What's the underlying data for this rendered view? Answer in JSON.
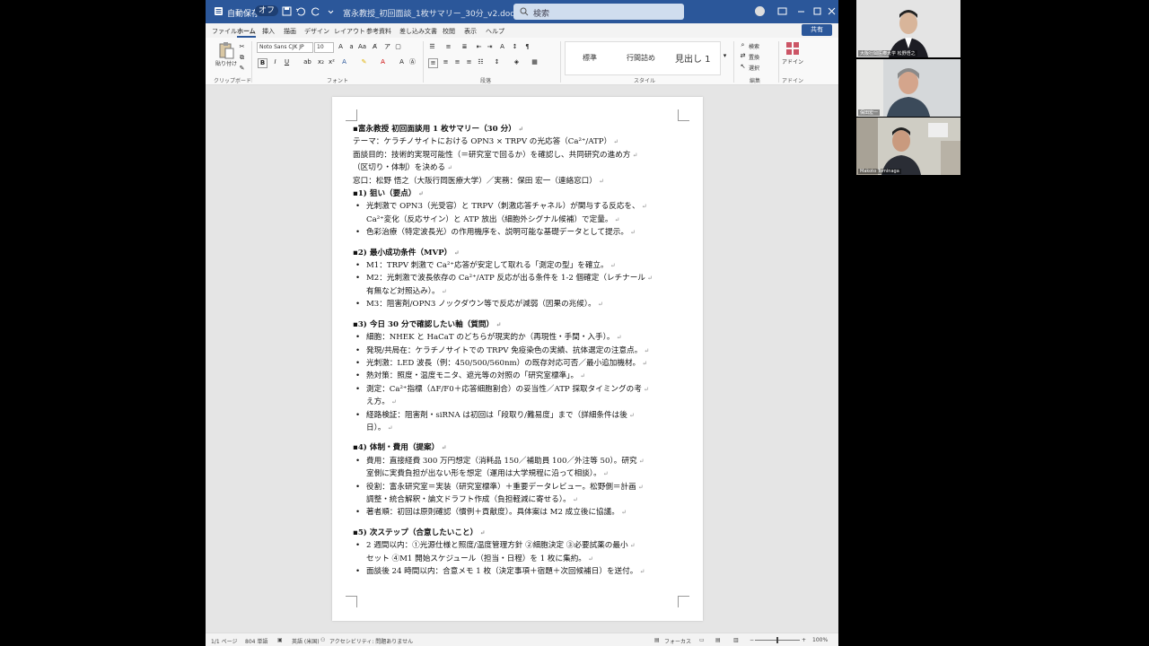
{
  "window": {
    "autosave_label": "自動保存",
    "autosave_state": "オフ",
    "doc_title": "富永教授_初回面談_1枚サマリー_30分_v2.docx ・ 保存",
    "search_placeholder": "検索"
  },
  "menu": {
    "tabs": [
      "ファイル",
      "ホーム",
      "挿入",
      "描画",
      "デザイン",
      "レイアウト",
      "参考資料",
      "差し込み文書",
      "校閲",
      "表示",
      "ヘルプ"
    ],
    "share_label": "共有"
  },
  "ribbon": {
    "paste_label": "貼り付け",
    "font_name": "Noto Sans CJK JP",
    "font_size": "10",
    "styles": [
      "標準",
      "行間詰め",
      "見出し 1"
    ],
    "find_label": "検索",
    "replace_label": "置換",
    "select_label": "選択",
    "addin_label": "アドイン",
    "groups": {
      "clipboard": "クリップボード",
      "font": "フォント",
      "paragraph": "段落",
      "style": "スタイル",
      "edit": "編集",
      "addin": "アドイン"
    }
  },
  "document": {
    "lines": [
      {
        "t": "▪富永教授 初回面談用 1 枚サマリー（30 分）",
        "k": "h"
      },
      {
        "t": "テーマ：ケラチノサイトにおける OPN3 × TRPV の光応答（Ca²⁺/ATP）",
        "k": "p"
      },
      {
        "t": "面談目的：技術的実現可能性（＝研究室で回るか）を確認し、共同研究の進め方",
        "k": "p"
      },
      {
        "t": "（区切り・体制）を決める",
        "k": "p"
      },
      {
        "t": "窓口：松野 悟之（大阪行岡医療大学）／実務：保田 宏一（連絡窓口）",
        "k": "p"
      },
      {
        "t": "▪1) 狙い（要点）",
        "k": "h"
      },
      {
        "t": "光刺激で OPN3（光受容）と TRPV（刺激応答チャネル）が関与する反応を、",
        "k": "b"
      },
      {
        "t": "Ca²⁺変化（反応サイン）と ATP 放出（細胞外シグナル候補）で定量。",
        "k": "c"
      },
      {
        "t": "色彩治療（特定波長光）の作用機序を、説明可能な基礎データとして提示。",
        "k": "b"
      },
      {
        "t": "",
        "k": "gap"
      },
      {
        "t": "▪2) 最小成功条件（MVP）",
        "k": "h"
      },
      {
        "t": "M1：TRPV 刺激で Ca²⁺応答が安定して取れる「測定の型」を確立。",
        "k": "b"
      },
      {
        "t": "M2：光刺激で波長依存の Ca²⁺/ATP 反応が出る条件を 1-2 個確定（レチナール",
        "k": "b"
      },
      {
        "t": "有無など対照込み）。",
        "k": "c"
      },
      {
        "t": "M3：阻害剤/OPN3 ノックダウン等で反応が減弱（因果の兆候）。",
        "k": "b"
      },
      {
        "t": "",
        "k": "gap"
      },
      {
        "t": "▪3) 今日 30 分で確認したい軸（質問）",
        "k": "h"
      },
      {
        "t": "細胞：NHEK と HaCaT のどちらが現実的か（再現性・手間・入手）。",
        "k": "b"
      },
      {
        "t": "発現/共局在：ケラチノサイトでの TRPV 免疫染色の実績、抗体選定の注意点。",
        "k": "b"
      },
      {
        "t": "光刺激：LED 波長（例：450/500/560nm）の既存対応可否／最小追加機材。",
        "k": "b"
      },
      {
        "t": "熱対策：照度・温度モニタ、遮光等の対照の「研究室標準」。",
        "k": "b"
      },
      {
        "t": "測定：Ca²⁺指標（ΔF/F0＋応答細胞割合）の妥当性／ATP 採取タイミングの考",
        "k": "b"
      },
      {
        "t": "え方。",
        "k": "c"
      },
      {
        "t": "経路検証：阻害剤・siRNA は初回は「段取り/難易度」まで（詳細条件は後",
        "k": "b"
      },
      {
        "t": "日）。",
        "k": "c"
      },
      {
        "t": "",
        "k": "gap"
      },
      {
        "t": "▪4) 体制・費用（提案）",
        "k": "h"
      },
      {
        "t": "費用：直接経費 300 万円想定（消耗品 150／補助員 100／外注等 50）。研究",
        "k": "b"
      },
      {
        "t": "室側に実費負担が出ない形を想定（運用は大学規程に沿って相談）。",
        "k": "c"
      },
      {
        "t": "役割：富永研究室＝実装（研究室標準）＋重要データレビュー。松野側＝計画",
        "k": "b"
      },
      {
        "t": "調整・統合解釈・論文ドラフト作成（負担軽減に寄せる）。",
        "k": "c"
      },
      {
        "t": "著者順：初回は原則確認（慣例＋貢献度）。具体案は M2 成立後に協議。",
        "k": "b"
      },
      {
        "t": "",
        "k": "gap"
      },
      {
        "t": "▪5) 次ステップ（合意したいこと）",
        "k": "h"
      },
      {
        "t": "2 週間以内：①光源仕様と照度/温度管理方針 ②細胞決定 ③必要試薬の最小",
        "k": "b"
      },
      {
        "t": "セット ④M1 開始スケジュール（担当・日程）を 1 枚に集約。",
        "k": "c"
      },
      {
        "t": "面談後 24 時間以内：合意メモ 1 枚（決定事項＋宿題＋次回候補日）を送付。",
        "k": "b"
      }
    ]
  },
  "status": {
    "page": "1/1 ページ",
    "words": "804 単語",
    "lang": "英語 (米国)",
    "accessibility": "アクセシビリティ: 問題ありません",
    "focus": "フォーカス",
    "zoom": "100%"
  },
  "participants": [
    {
      "name": "大阪行岡医療大学 松野悟之"
    },
    {
      "name": "保田宏一"
    },
    {
      "name": "Makoto Tominaga"
    }
  ],
  "colors": {
    "word_blue": "#2b579a"
  }
}
